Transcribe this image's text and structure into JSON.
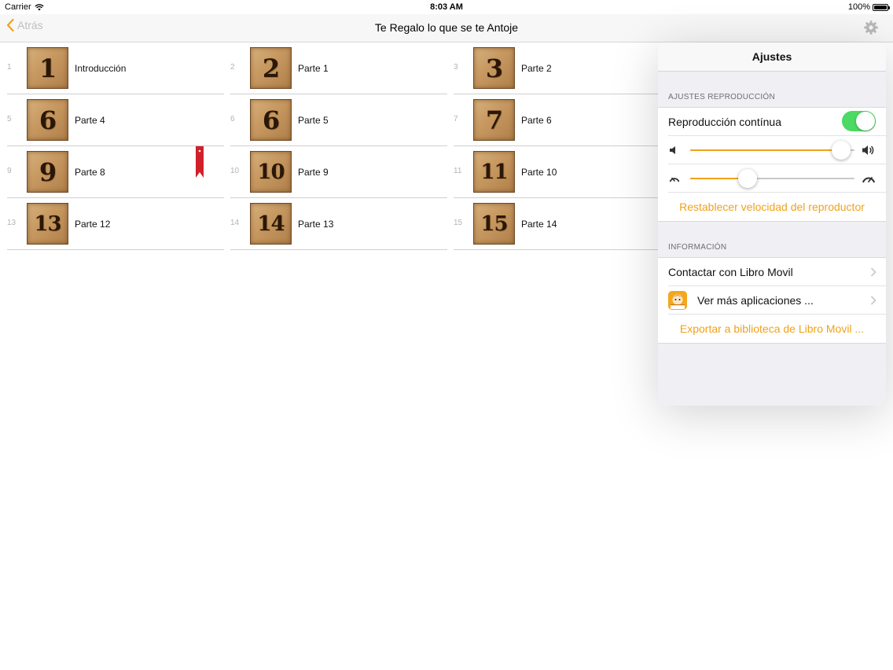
{
  "status": {
    "carrier": "Carrier",
    "time": "8:03 AM",
    "battery": "100%"
  },
  "nav": {
    "back_label": "Atrás",
    "title": "Te Regalo lo que se te Antoje"
  },
  "chapters": [
    {
      "index": "1",
      "tile": "1",
      "label": "Introducción"
    },
    {
      "index": "2",
      "tile": "2",
      "label": "Parte 1"
    },
    {
      "index": "3",
      "tile": "3",
      "label": "Parte 2"
    },
    {
      "index": "5",
      "tile": "6",
      "label": "Parte 4"
    },
    {
      "index": "6",
      "tile": "6",
      "label": "Parte 5"
    },
    {
      "index": "7",
      "tile": "7",
      "label": "Parte 6"
    },
    {
      "index": "9",
      "tile": "9",
      "label": "Parte 8",
      "bookmarked": true
    },
    {
      "index": "10",
      "tile": "10",
      "label": "Parte 9"
    },
    {
      "index": "11",
      "tile": "11",
      "label": "Parte 10"
    },
    {
      "index": "13",
      "tile": "13",
      "label": "Parte 12"
    },
    {
      "index": "14",
      "tile": "14",
      "label": "Parte 13"
    },
    {
      "index": "15",
      "tile": "15",
      "label": "Parte 14"
    }
  ],
  "settings": {
    "title": "Ajustes",
    "playback_section": "AJUSTES REPRODUCCIÓN",
    "continuous_label": "Reproducción contínua",
    "continuous_on": true,
    "volume_level": 0.92,
    "speed_level": 0.35,
    "reset_speed_label": "Restablecer velocidad del reproductor",
    "info_section": "INFORMACIÓN",
    "contact_label": "Contactar con Libro Movil",
    "more_apps_label": "Ver más aplicaciones ...",
    "export_label": "Exportar a biblioteca de Libro Movil ..."
  },
  "colors": {
    "accent": "#f0a21a",
    "toggle_on": "#4cd964",
    "bookmark": "#d0202a"
  }
}
